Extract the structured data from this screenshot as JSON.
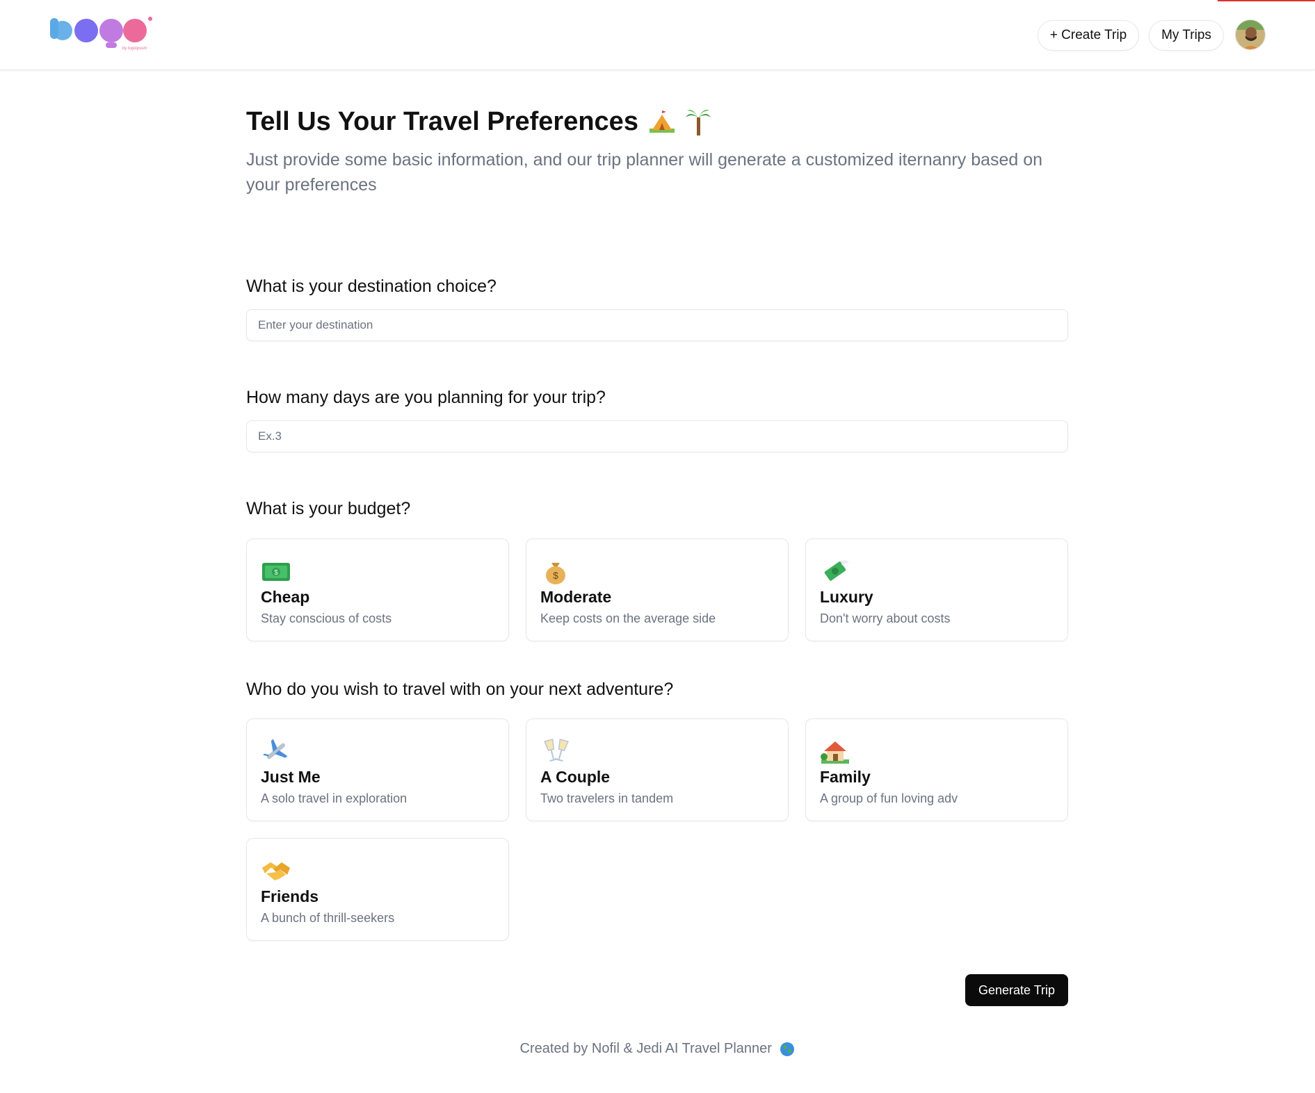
{
  "header": {
    "logo_alt": "Logo",
    "logo_caption": "by logoipsum",
    "create_trip_label": "+ Create Trip",
    "my_trips_label": "My Trips",
    "avatar_icon": "user-avatar"
  },
  "hero": {
    "title": "Tell Us Your Travel Preferences",
    "title_icons": [
      "camping-icon",
      "palm-tree-icon"
    ],
    "subtitle": "Just provide some basic information, and our trip planner will generate a customized iternanry based on your preferences"
  },
  "destination": {
    "question": "What is your destination choice?",
    "placeholder": "Enter your destination",
    "value": ""
  },
  "days": {
    "question": "How many days are you planning for your trip?",
    "placeholder": "Ex.3",
    "value": ""
  },
  "budget": {
    "question": "What is your budget?",
    "options": [
      {
        "icon": "cash-icon",
        "title": "Cheap",
        "desc": "Stay conscious of costs"
      },
      {
        "icon": "money-bag-icon",
        "title": "Moderate",
        "desc": "Keep costs on the average side"
      },
      {
        "icon": "money-wings-icon",
        "title": "Luxury",
        "desc": "Don't worry about costs"
      }
    ]
  },
  "travelers": {
    "question": "Who do you wish to travel with on your next adventure?",
    "options": [
      {
        "icon": "airplane-icon",
        "title": "Just Me",
        "desc": "A solo travel in exploration"
      },
      {
        "icon": "clinking-glasses-icon",
        "title": "A Couple",
        "desc": "Two travelers in tandem"
      },
      {
        "icon": "house-icon",
        "title": "Family",
        "desc": "A group of fun loving adv"
      },
      {
        "icon": "handshake-icon",
        "title": "Friends",
        "desc": "A bunch of thrill-seekers"
      }
    ]
  },
  "generate_label": "Generate Trip",
  "footer": {
    "text": "Created by Nofil & Jedi AI Travel Planner",
    "icon": "globe-icon"
  },
  "colors": {
    "primary_button": "#0b0b0b",
    "muted_text": "#6b7280",
    "border": "#e5e7eb"
  }
}
